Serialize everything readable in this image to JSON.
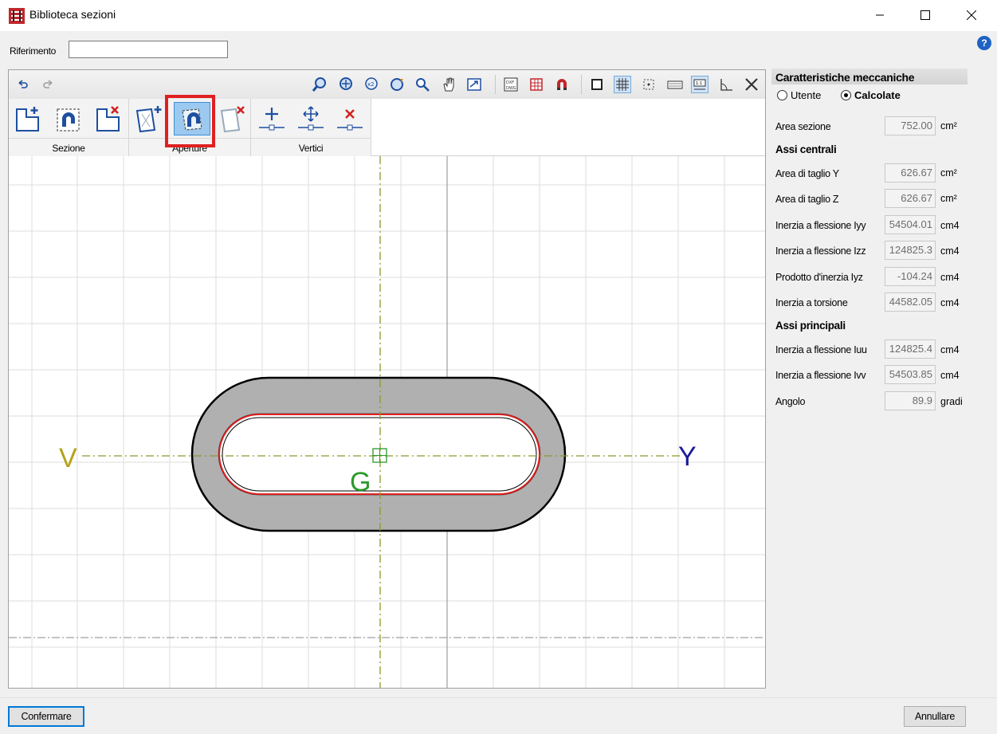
{
  "window": {
    "title": "Biblioteca sezioni",
    "app_icon": "app-logo-icon",
    "controls": [
      "minimize-icon",
      "maximize-icon",
      "close-icon"
    ]
  },
  "reference": {
    "label": "Riferimento",
    "value": ""
  },
  "help_label": "?",
  "toolbar": {
    "icons": [
      "undo-icon",
      "redo-icon",
      "zoom-window-icon",
      "zoom-extents-icon",
      "zoom-x2-icon",
      "regenerate-icon",
      "zoom-icon",
      "pan-hand-icon",
      "view-icon",
      "dxf-dwg-icon",
      "layers-icon",
      "snap-magnet-icon",
      "square-icon",
      "grid-icon",
      "snap-point-icon",
      "keyboard-icon",
      "scale-icon",
      "angle-icon",
      "tools-icon"
    ]
  },
  "ribbon": {
    "groups": [
      {
        "label": "Sezione",
        "buttons": [
          "add-section-icon",
          "edit-section-icon",
          "delete-section-icon"
        ]
      },
      {
        "label": "Aperture",
        "buttons": [
          "add-opening-icon",
          "edit-opening-icon",
          "delete-opening-icon"
        ]
      },
      {
        "label": "Vertici",
        "buttons": [
          "add-vertex-icon",
          "move-vertex-icon",
          "delete-vertex-icon"
        ]
      }
    ]
  },
  "canvas": {
    "axis_v_label": "V",
    "axis_y_label": "Y",
    "centroid_label": "G",
    "colors": {
      "section_fill": "#b0b0b0",
      "outline": "#000000",
      "opening": "#e02020",
      "axes": "#8a9a2a",
      "centroid": "#2a9a2a",
      "label_v": "#b5a21a",
      "label_y": "#1a1a9a",
      "label_g": "#2a9a2a"
    }
  },
  "properties": {
    "title": "Caratteristiche meccaniche",
    "mode_options": [
      {
        "label": "Utente",
        "selected": false
      },
      {
        "label": "Calcolate",
        "selected": true
      }
    ],
    "area": {
      "label": "Area sezione",
      "value": "752.00",
      "unit": "cm²"
    },
    "central_axes": {
      "title": "Assi centrali",
      "rows": [
        {
          "label": "Area di taglio Y",
          "value": "626.67",
          "unit": "cm²"
        },
        {
          "label": "Area di taglio Z",
          "value": "626.67",
          "unit": "cm²"
        },
        {
          "label": "Inerzia a flessione Iyy",
          "value": "54504.01",
          "unit": "cm4"
        },
        {
          "label": "Inerzia a flessione Izz",
          "value": "124825.3",
          "unit": "cm4"
        },
        {
          "label": "Prodotto d'inerzia Iyz",
          "value": "-104.24",
          "unit": "cm4"
        },
        {
          "label": "Inerzia a torsione",
          "value": "44582.05",
          "unit": "cm4"
        }
      ]
    },
    "principal_axes": {
      "title": "Assi principali",
      "rows": [
        {
          "label": "Inerzia a flessione Iuu",
          "value": "124825.4",
          "unit": "cm4"
        },
        {
          "label": "Inerzia a flessione Ivv",
          "value": "54503.85",
          "unit": "cm4"
        },
        {
          "label": "Angolo",
          "value": "89.9",
          "unit": "gradi"
        }
      ]
    }
  },
  "buttons": {
    "confirm": "Confermare",
    "cancel": "Annullare"
  }
}
